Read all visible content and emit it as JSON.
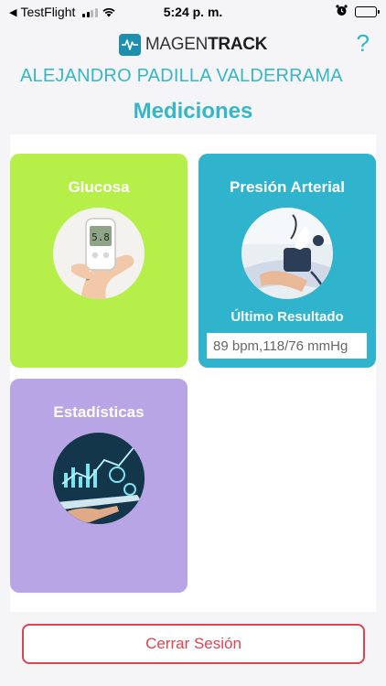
{
  "status_bar": {
    "back_app": "TestFlight",
    "time": "5:24 p. m."
  },
  "header": {
    "logo_prefix": "MAGEN",
    "logo_suffix": "TRACK",
    "help": "?"
  },
  "user": {
    "name": "ALEJANDRO PADILLA VALDERRAMA"
  },
  "page": {
    "title": "Mediciones"
  },
  "cards": {
    "glucosa": {
      "title": "Glucosa",
      "icon": "glucometer-image",
      "color": "#b7ef4a"
    },
    "presion": {
      "title": "Presión Arterial",
      "icon": "blood-pressure-image",
      "color": "#30b3cc",
      "last_label": "Último Resultado",
      "last_value": "89 bpm,118/76 mmHg"
    },
    "estadisticas": {
      "title": "Estadísticas",
      "icon": "statistics-image",
      "color": "#b7a5e6"
    }
  },
  "logout": {
    "label": "Cerrar Sesión",
    "color": "#e0424e"
  },
  "colors": {
    "accent": "#36b6c9"
  }
}
